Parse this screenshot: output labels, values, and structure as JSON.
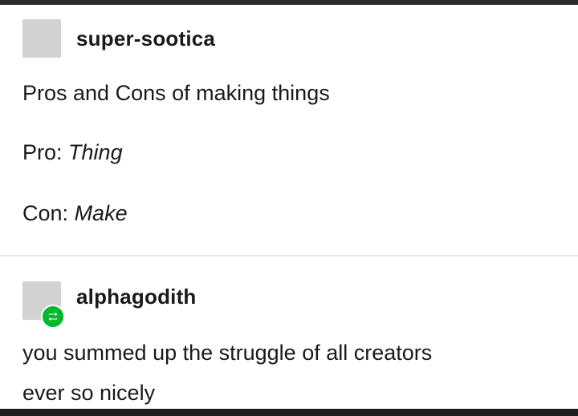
{
  "post1": {
    "username": "super-sootica",
    "title": "Pros and Cons of making things",
    "pro_label": "Pro:",
    "pro_value": "Thing",
    "con_label": "Con:",
    "con_value": "Make"
  },
  "post2": {
    "username": "alphagodith",
    "line1": "you summed up the struggle of all creators",
    "line2": "ever so nicely",
    "badge_icon": "reblog-icon",
    "badge_color": "#00b82e"
  }
}
